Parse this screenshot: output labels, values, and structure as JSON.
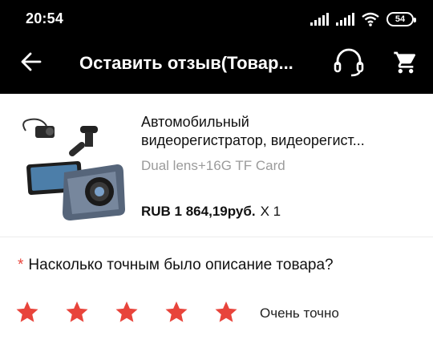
{
  "status_bar": {
    "time": "20:54",
    "battery": "54"
  },
  "header": {
    "title": "Оставить отзыв(Товар...",
    "icons": [
      "back-arrow-icon",
      "headset-icon",
      "cart-icon"
    ]
  },
  "product": {
    "name_line1": "Автомобильный",
    "name_line2": "видеорегистратор, видеорегист...",
    "variant": "Dual lens+16G TF Card",
    "price": "RUB 1 864,19руб.",
    "quantity": "X 1"
  },
  "question": {
    "required_mark": "*",
    "text": "Насколько точным было описание товара?"
  },
  "rating": {
    "value": 5,
    "max": 5,
    "label": "Очень точно"
  },
  "colors": {
    "header_bg": "#000000",
    "star": "#e8443b",
    "required": "#e8443b",
    "variant_text": "#9b9b9b"
  }
}
